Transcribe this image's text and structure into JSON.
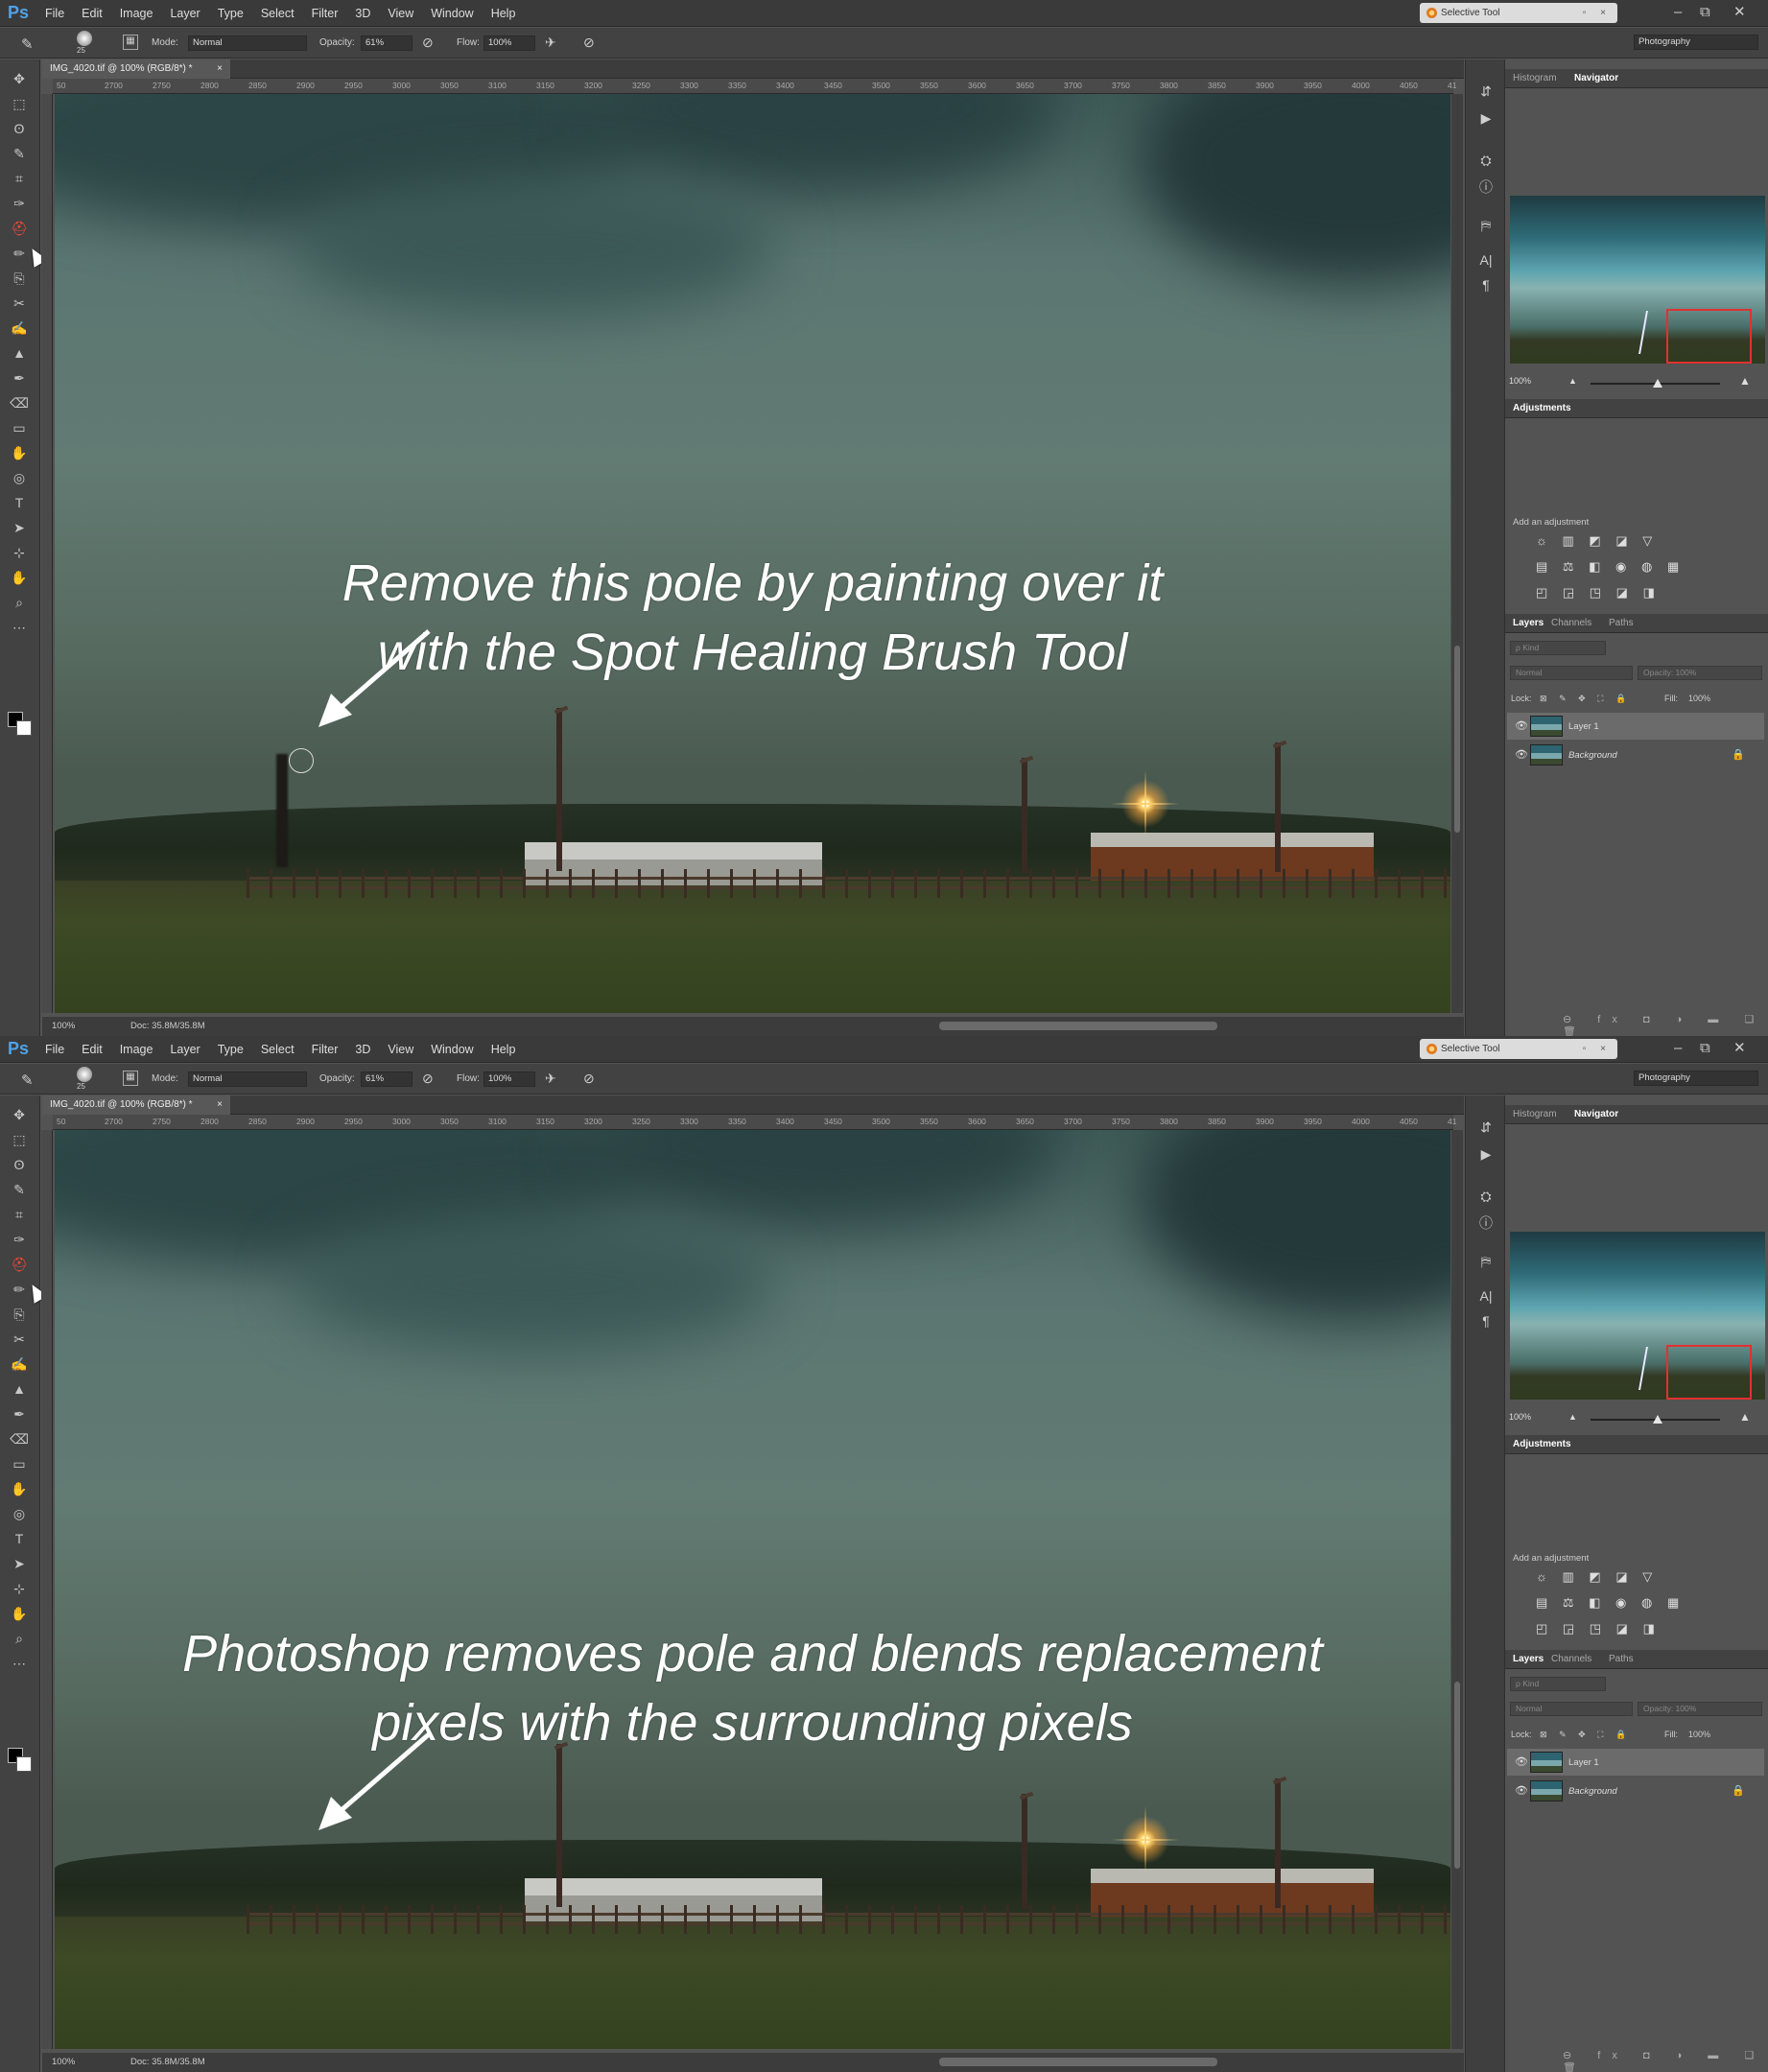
{
  "menu": {
    "logo": "Ps",
    "items": [
      "File",
      "Edit",
      "Image",
      "Layer",
      "Type",
      "Select",
      "Filter",
      "3D",
      "View",
      "Window",
      "Help"
    ],
    "selective_tool": "Selective Tool",
    "selective_btns": "▫ ×",
    "win_min": "–",
    "win_restore": "⧉",
    "win_close": "✕"
  },
  "options": {
    "brush_size": "25",
    "mode_label": "Mode:",
    "mode_value": "Normal",
    "opacity_label": "Opacity:",
    "opacity_value": "61%",
    "flow_label": "Flow:",
    "flow_value": "100%",
    "workspace": "Photography"
  },
  "document": {
    "tab": "IMG_4020.tif @ 100% (RGB/8*) *",
    "tab_close": "×",
    "ruler_ticks": [
      "50",
      "2700",
      "2750",
      "2800",
      "2850",
      "2900",
      "2950",
      "3000",
      "3050",
      "3100",
      "3150",
      "3200",
      "3250",
      "3300",
      "3350",
      "3400",
      "3450",
      "3500",
      "3550",
      "3600",
      "3650",
      "3700",
      "3750",
      "3800",
      "3850",
      "3900",
      "3950",
      "4000",
      "4050",
      "41"
    ],
    "zoom": "100%",
    "doc_size": "Doc: 35.8M/35.8M"
  },
  "annotations": {
    "top_line1": "Remove this pole by painting over it",
    "top_line2": "with the Spot Healing Brush Tool",
    "bottom_line1": "Photoshop removes pole and blends replacement",
    "bottom_line2": "pixels with the surrounding pixels"
  },
  "panels": {
    "histogram_tab": "Histogram",
    "navigator_tab": "Navigator",
    "nav_zoom": "100%",
    "adjustments_title": "Adjustments",
    "adjustments_sub": "Add an adjustment",
    "adj_row1": "☼ ▥ ◩ ◪ ▽",
    "adj_row2": "▤ ⚖ ◧ ◉ ◍ ▦",
    "adj_row3": "◰ ◲ ◳ ◪ ◨",
    "layers_tab": "Layers",
    "channels_tab": "Channels",
    "paths_tab": "Paths",
    "kind_placeholder": "ρ Kind",
    "blend_mode": "Normal",
    "layer_opacity": "Opacity: 100%",
    "lock_label": "Lock:",
    "lock_icons": "⊠ ✎ ✥ ⛶ 🔒",
    "fill_label": "Fill:",
    "fill_value": "100%",
    "layers": [
      {
        "name": "Layer 1"
      },
      {
        "name": "Background"
      }
    ],
    "footer_icons": "⊖ fx ◘ ◑ ▬ ❏ 🗑"
  },
  "tool_icons": [
    "✥",
    "⬚",
    "ʘ",
    "✎",
    "⌗",
    "✑",
    "⛑",
    "✏",
    "⎘",
    "✂",
    "✍",
    "▲",
    "✒",
    "⌫",
    "▭",
    "✋",
    "◎",
    "T",
    "➤",
    "⊹",
    "✋",
    "⌕",
    "⋯"
  ],
  "dock_icons": [
    "⇵",
    "▶",
    "⛭",
    "ⓘ",
    "⛿",
    "A|",
    "¶"
  ]
}
